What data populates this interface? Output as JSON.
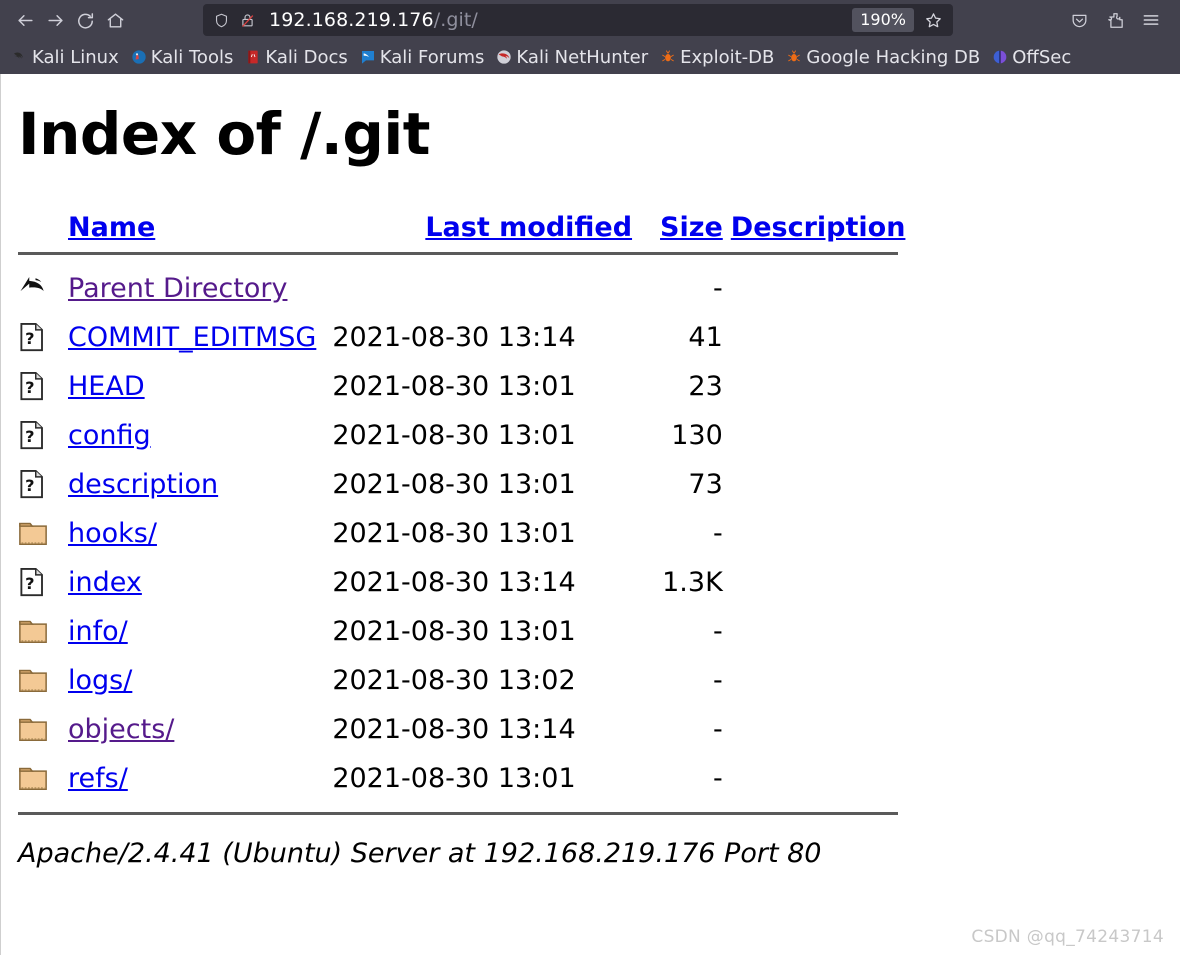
{
  "browser": {
    "nav": {
      "back": "back-arrow",
      "forward": "forward-arrow",
      "reload": "reload",
      "home": "home"
    },
    "urlbar": {
      "shield_icon": "shield-icon",
      "lock_icon": "lock-crossed-icon",
      "url_host": "192.168.219.176",
      "url_path": "/.git/",
      "zoom_level": "190%",
      "bookmark_icon": "star-icon"
    },
    "toolbar_right": {
      "pocket": "pocket-icon",
      "extensions": "extensions-icon",
      "menu": "hamburger-menu-icon"
    },
    "bookmarks": [
      {
        "label": "Kali Linux",
        "icon": "kali-dragon-icon"
      },
      {
        "label": "Kali Tools",
        "icon": "kali-tools-icon"
      },
      {
        "label": "Kali Docs",
        "icon": "kali-docs-icon"
      },
      {
        "label": "Kali Forums",
        "icon": "kali-forums-icon"
      },
      {
        "label": "Kali NetHunter",
        "icon": "kali-nethunter-icon"
      },
      {
        "label": "Exploit-DB",
        "icon": "exploitdb-icon"
      },
      {
        "label": "Google Hacking DB",
        "icon": "ghdb-icon"
      },
      {
        "label": "OffSec",
        "icon": "offsec-icon"
      }
    ]
  },
  "page": {
    "title": "Index of /.git",
    "headers": {
      "name": "Name",
      "last_modified": "Last modified",
      "size": "Size",
      "description": "Description"
    },
    "rows": [
      {
        "icon": "parent-directory-icon",
        "name": "Parent Directory",
        "visited": true,
        "date": "",
        "size": "-",
        "desc": ""
      },
      {
        "icon": "unknown-file-icon",
        "name": "COMMIT_EDITMSG",
        "visited": false,
        "date": "2021-08-30 13:14",
        "size": "41",
        "desc": ""
      },
      {
        "icon": "unknown-file-icon",
        "name": "HEAD",
        "visited": false,
        "date": "2021-08-30 13:01",
        "size": "23",
        "desc": ""
      },
      {
        "icon": "unknown-file-icon",
        "name": "config",
        "visited": false,
        "date": "2021-08-30 13:01",
        "size": "130",
        "desc": ""
      },
      {
        "icon": "unknown-file-icon",
        "name": "description",
        "visited": false,
        "date": "2021-08-30 13:01",
        "size": "73",
        "desc": ""
      },
      {
        "icon": "folder-icon",
        "name": "hooks/",
        "visited": false,
        "date": "2021-08-30 13:01",
        "size": "-",
        "desc": ""
      },
      {
        "icon": "unknown-file-icon",
        "name": "index",
        "visited": false,
        "date": "2021-08-30 13:14",
        "size": "1.3K",
        "desc": ""
      },
      {
        "icon": "folder-icon",
        "name": "info/",
        "visited": false,
        "date": "2021-08-30 13:01",
        "size": "-",
        "desc": ""
      },
      {
        "icon": "folder-icon",
        "name": "logs/",
        "visited": false,
        "date": "2021-08-30 13:02",
        "size": "-",
        "desc": ""
      },
      {
        "icon": "folder-icon",
        "name": "objects/",
        "visited": true,
        "date": "2021-08-30 13:14",
        "size": "-",
        "desc": ""
      },
      {
        "icon": "folder-icon",
        "name": "refs/",
        "visited": false,
        "date": "2021-08-30 13:01",
        "size": "-",
        "desc": ""
      }
    ],
    "footer": "Apache/2.4.41 (Ubuntu) Server at 192.168.219.176 Port 80",
    "watermark": "CSDN @qq_74243714"
  },
  "colors": {
    "chrome_bg": "#42414d",
    "urlbar_bg": "#2b2a33",
    "link": "#0000ee",
    "visited_link": "#551a8b",
    "folder": "#f0c890",
    "hr": "#5a5a5a"
  }
}
